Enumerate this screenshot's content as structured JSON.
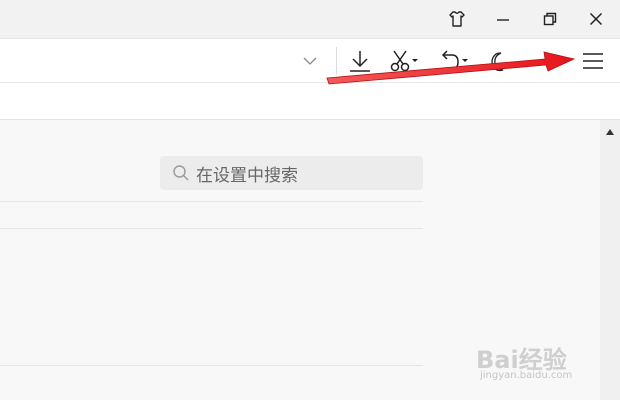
{
  "window_controls": {
    "skin_icon": "tshirt-icon",
    "minimize_icon": "minimize-icon",
    "restore_icon": "restore-icon",
    "close_icon": "close-icon"
  },
  "toolbar": {
    "icons": [
      "chevron-down-icon",
      "download-icon",
      "scissors-icon",
      "undo-icon",
      "moon-icon",
      "menu-icon"
    ]
  },
  "settings": {
    "search_placeholder": "在设置中搜索"
  },
  "annotation": {
    "arrow_color": "#e8141a"
  },
  "watermark": {
    "main": "Bai经验",
    "sub": "jingyan.baidu.com"
  }
}
